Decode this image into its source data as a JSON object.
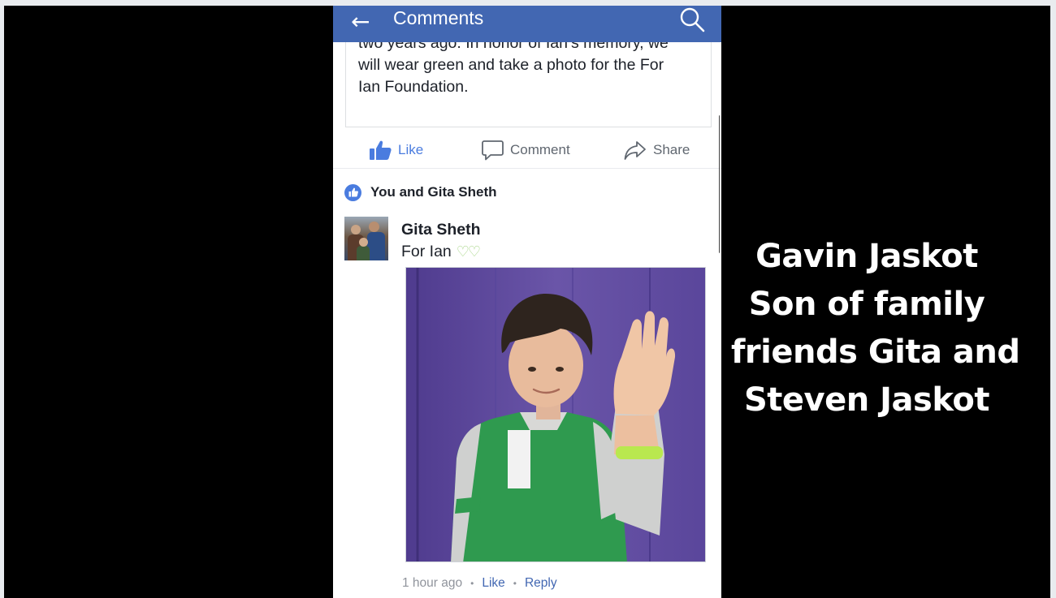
{
  "header": {
    "back_icon": "arrow-left-icon",
    "title": "Comments",
    "search_icon": "search-icon",
    "bar_color": "#4267b2"
  },
  "post": {
    "text_lines": [
      "two years ago. In honor of Ian’s memory, we",
      "will wear green and take a photo for the For",
      "Ian Foundation."
    ]
  },
  "actions": {
    "like": "Like",
    "comment": "Comment",
    "share": "Share",
    "like_color": "#4a7cdf"
  },
  "reactions": {
    "icon": "thumbs-up-icon",
    "text": "You and Gita Sheth"
  },
  "comment": {
    "author": "Gita Sheth",
    "text": "For Ian",
    "emoji": "💚💚",
    "photo_alt": "Boy in green and gray shirt raising his arm to show a lime green wristband in front of a purple wall",
    "time": "1 hour ago",
    "like_link": "Like",
    "reply_link": "Reply"
  },
  "caption": {
    "lines": [
      "Gavin Jaskot",
      "Son of family",
      "friends Gita and",
      "Steven Jaskot"
    ]
  }
}
